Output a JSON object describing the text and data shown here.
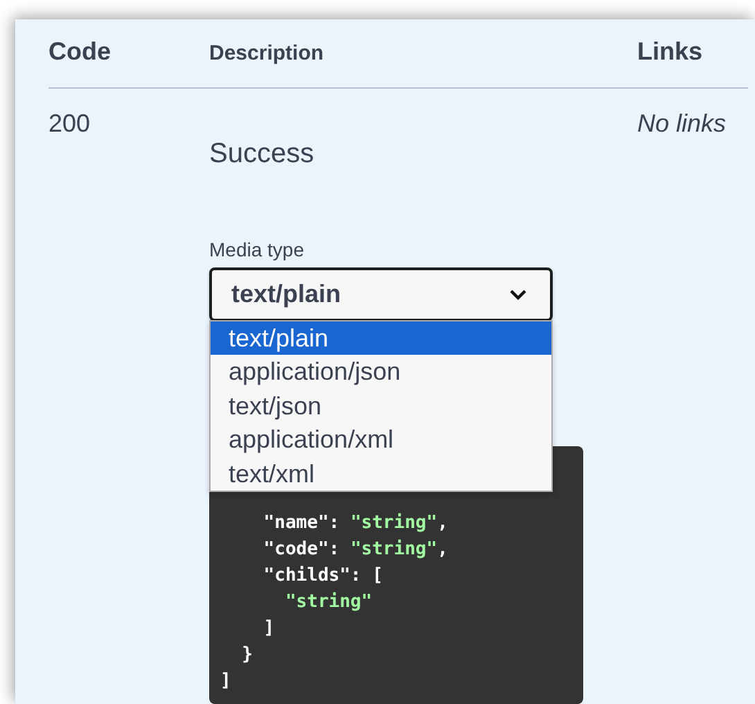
{
  "table": {
    "columns": [
      "Code",
      "Description",
      "Links"
    ],
    "rows": [
      {
        "code": "200",
        "description": "Success",
        "links": "No links",
        "media_type": {
          "label": "Media type",
          "value": "text/plain",
          "expanded": true,
          "options": [
            {
              "label": "text/plain",
              "selected": true
            },
            {
              "label": "application/json",
              "selected": false
            },
            {
              "label": "text/json",
              "selected": false
            },
            {
              "label": "application/xml",
              "selected": false
            },
            {
              "label": "text/xml",
              "selected": false
            }
          ]
        },
        "example": [
          [
            {
              "kind": "key",
              "text": "    \"name\""
            },
            {
              "kind": "punct",
              "text": ": "
            },
            {
              "kind": "string",
              "text": "\"string\""
            },
            {
              "kind": "punct",
              "text": ","
            }
          ],
          [
            {
              "kind": "key",
              "text": "    \"code\""
            },
            {
              "kind": "punct",
              "text": ": "
            },
            {
              "kind": "string",
              "text": "\"string\""
            },
            {
              "kind": "punct",
              "text": ","
            }
          ],
          [
            {
              "kind": "key",
              "text": "    \"childs\""
            },
            {
              "kind": "punct",
              "text": ": ["
            }
          ],
          [
            {
              "kind": "string",
              "text": "      \"string\""
            }
          ],
          [
            {
              "kind": "punct",
              "text": "    ]"
            }
          ],
          [
            {
              "kind": "punct",
              "text": "  }"
            }
          ],
          [
            {
              "kind": "punct",
              "text": "]"
            }
          ]
        ]
      }
    ]
  }
}
